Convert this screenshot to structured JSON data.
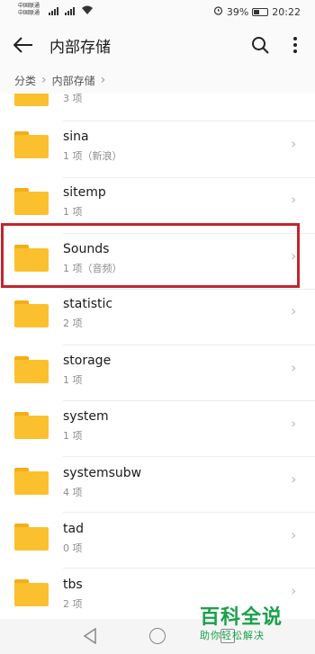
{
  "status_bar": {
    "carrier_1": "中国联通",
    "carrier_2": "中国联通",
    "battery": "39%",
    "time": "20:22"
  },
  "header": {
    "title": "内部存储"
  },
  "breadcrumb": [
    "分类",
    "内部存储"
  ],
  "files": [
    {
      "name": "",
      "meta": "3 项"
    },
    {
      "name": "sina",
      "meta": "1 项（新浪）"
    },
    {
      "name": "sitemp",
      "meta": "1 项"
    },
    {
      "name": "Sounds",
      "meta": "1 项（音频）"
    },
    {
      "name": "statistic",
      "meta": "2 项"
    },
    {
      "name": "storage",
      "meta": "1 项"
    },
    {
      "name": "system",
      "meta": "1 项"
    },
    {
      "name": "systemsubw",
      "meta": "4 项"
    },
    {
      "name": "tad",
      "meta": "0 项"
    },
    {
      "name": "tbs",
      "meta": "2 项"
    }
  ],
  "watermark": {
    "big": "百科全说",
    "small": "助你轻松解决"
  },
  "colors": {
    "folder": "#fbc02d",
    "highlight": "#c0262d"
  }
}
